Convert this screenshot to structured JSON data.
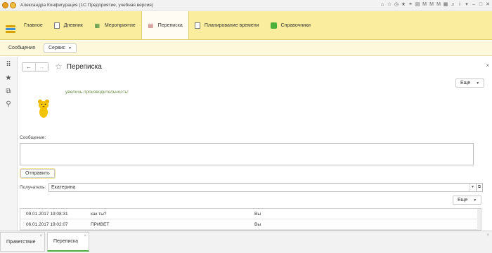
{
  "window": {
    "title": "Александра Конфигурация  (1С:Предприятие, учебная версия)"
  },
  "sections": [
    {
      "label": "Главное",
      "icon": "menu-list-icon"
    },
    {
      "label": "Дневник",
      "icon": "document-icon"
    },
    {
      "label": "Мероприятие",
      "icon": "grid-icon"
    },
    {
      "label": "Переписка",
      "icon": "calendar-icon",
      "active": true
    },
    {
      "label": "Планирование времени",
      "icon": "document-icon"
    },
    {
      "label": "Справочники",
      "icon": "book-icon"
    }
  ],
  "subbar": {
    "messages": "Сообщения",
    "service": "Сервис"
  },
  "form": {
    "title": "Переписка",
    "more": "Еще",
    "slogan": "увеличь производительность!",
    "message_label": "Сообщение:",
    "message_value": "",
    "send": "Отправить",
    "recipient_label": "Получатель:",
    "recipient_value": "Екатерина",
    "more2": "Еще",
    "rows": [
      {
        "date": "09.01.2017 19:08:31",
        "text": "как ты?",
        "from": "Вы"
      },
      {
        "date": "06.01.2017 19:02:07",
        "text": "ПРИВЕТ",
        "from": "Вы"
      }
    ]
  },
  "tabs": [
    {
      "label": "Приветствие"
    },
    {
      "label": "Переписка",
      "active": true
    }
  ],
  "colors": {
    "accent": "#fbed9e",
    "active_tab": "#4caf3a",
    "slogan": "#6f8f4a"
  }
}
